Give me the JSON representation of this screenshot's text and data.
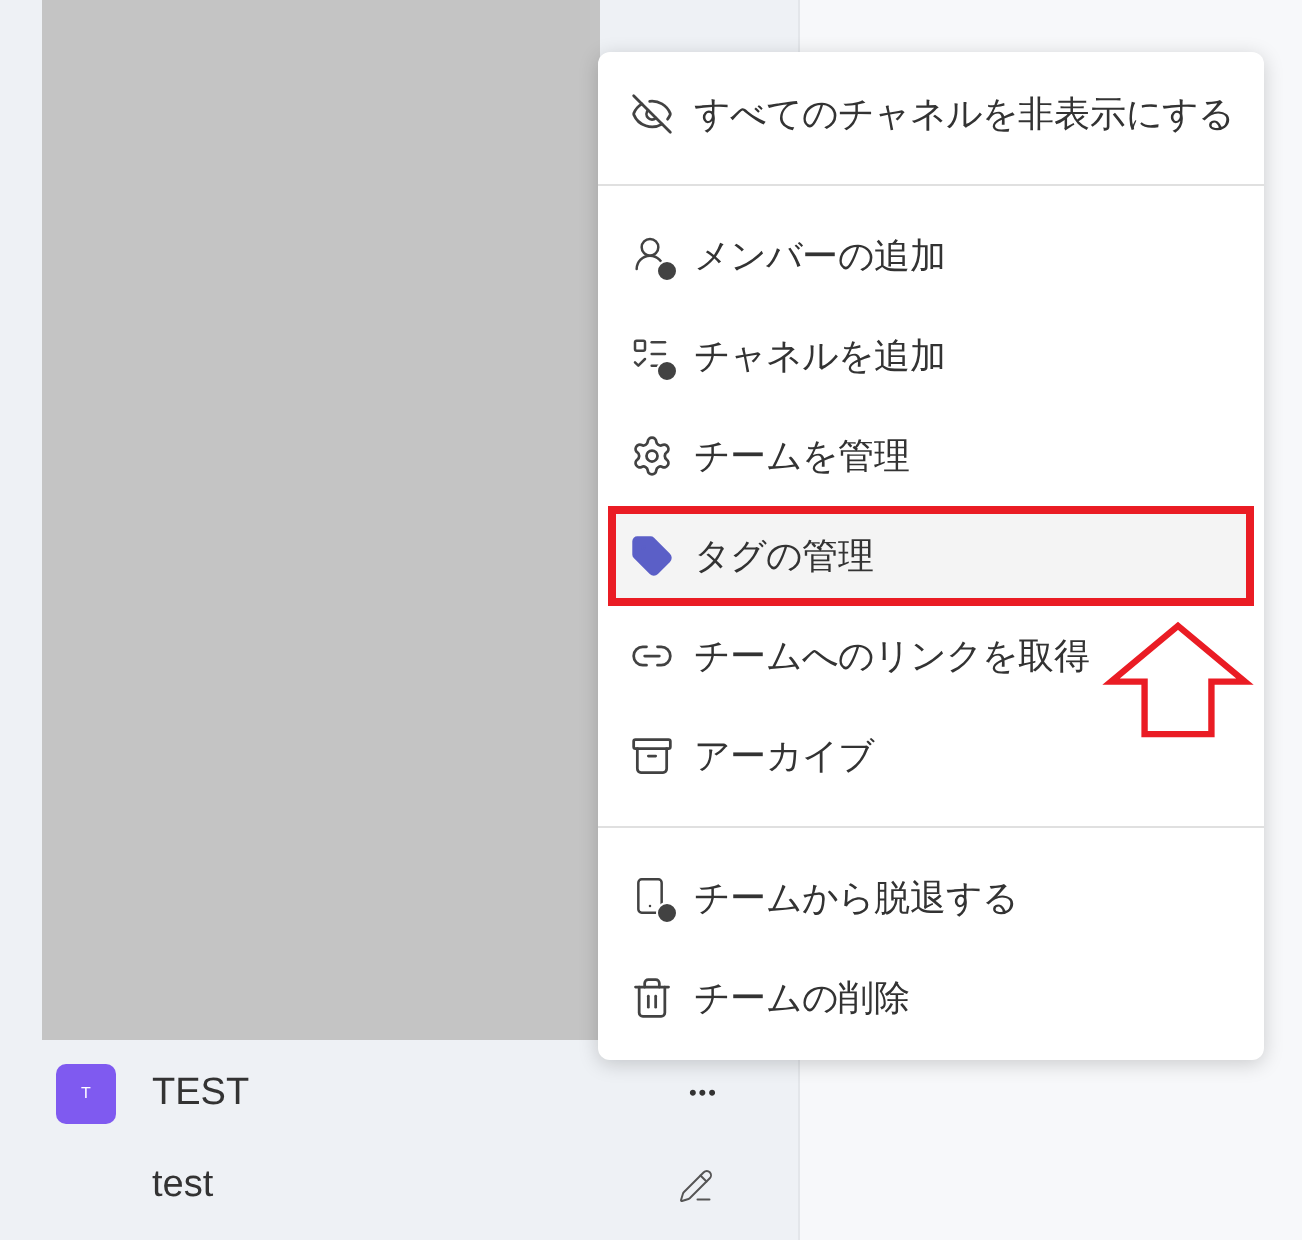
{
  "team": {
    "avatar": "T",
    "name": "TEST",
    "more": "•••",
    "channels": [
      {
        "name": "test"
      }
    ]
  },
  "context_menu": {
    "sections": [
      {
        "items": [
          {
            "label": "すべてのチャネルを非表示にする",
            "selected": false
          }
        ]
      },
      {
        "items": [
          {
            "label": "メンバーの追加",
            "selected": false
          },
          {
            "label": "チャネルを追加",
            "selected": false
          },
          {
            "label": "チームを管理",
            "selected": false
          },
          {
            "label": "タグの管理",
            "selected": true
          },
          {
            "label": "チームへのリンクを取得",
            "selected": false
          },
          {
            "label": "アーカイブ",
            "selected": false
          }
        ]
      },
      {
        "items": [
          {
            "label": "チームから脱退する",
            "selected": false
          },
          {
            "label": "チームの削除",
            "selected": false
          }
        ]
      }
    ]
  }
}
